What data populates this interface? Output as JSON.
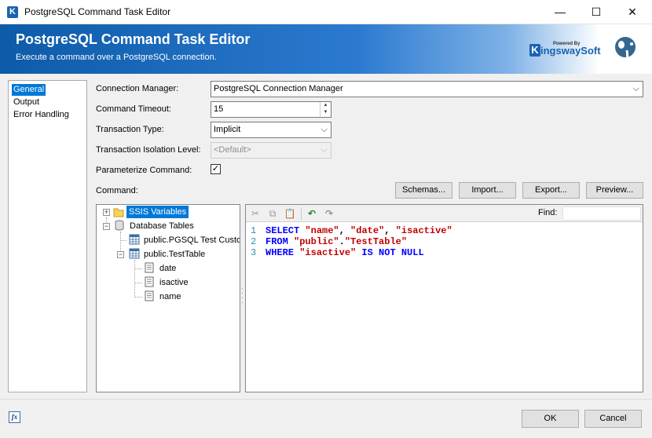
{
  "window": {
    "title": "PostgreSQL Command Task Editor",
    "minimize_glyph": "—",
    "maximize_glyph": "☐",
    "close_glyph": "✕"
  },
  "banner": {
    "title": "PostgreSQL Command Task Editor",
    "subtitle": "Execute a command over a PostgreSQL connection.",
    "brand_powered": "Powered By",
    "brand_name": "ingswaySoft",
    "brand_letter": "K"
  },
  "nav": {
    "items": [
      {
        "label": "General",
        "selected": true
      },
      {
        "label": "Output",
        "selected": false
      },
      {
        "label": "Error Handling",
        "selected": false
      }
    ]
  },
  "form": {
    "connection_manager_label": "Connection Manager:",
    "connection_manager_value": "PostgreSQL Connection Manager",
    "command_timeout_label": "Command Timeout:",
    "command_timeout_value": "15",
    "transaction_type_label": "Transaction Type:",
    "transaction_type_value": "Implicit",
    "isolation_level_label": "Transaction Isolation Level:",
    "isolation_level_value": "<Default>",
    "parameterize_label": "Parameterize Command:",
    "parameterize_checked": true,
    "command_label": "Command:"
  },
  "buttons": {
    "schemas": "Schemas...",
    "import": "Import...",
    "export": "Export...",
    "preview": "Preview...",
    "ok": "OK",
    "cancel": "Cancel"
  },
  "tree": {
    "ssis_variables": "SSIS Variables",
    "database_tables": "Database Tables",
    "table1": "public.PGSQL Test Custo",
    "table2": "public.TestTable",
    "columns": [
      "date",
      "isactive",
      "name"
    ]
  },
  "editor": {
    "find_label": "Find:",
    "line_numbers": [
      "1",
      "2",
      "3"
    ],
    "lines": [
      [
        {
          "t": "SELECT ",
          "c": "kw"
        },
        {
          "t": "\"name\"",
          "c": "str"
        },
        {
          "t": ", ",
          "c": "pl"
        },
        {
          "t": "\"date\"",
          "c": "str"
        },
        {
          "t": ", ",
          "c": "pl"
        },
        {
          "t": "\"isactive\"",
          "c": "str"
        }
      ],
      [
        {
          "t": "FROM ",
          "c": "kw"
        },
        {
          "t": "\"public\"",
          "c": "str"
        },
        {
          "t": ".",
          "c": "pl"
        },
        {
          "t": "\"TestTable\"",
          "c": "str"
        }
      ],
      [
        {
          "t": "WHERE ",
          "c": "kw"
        },
        {
          "t": "\"isactive\"",
          "c": "str"
        },
        {
          "t": " IS NOT NULL",
          "c": "kw"
        }
      ]
    ]
  },
  "footer": {
    "fx_label": "fx"
  }
}
